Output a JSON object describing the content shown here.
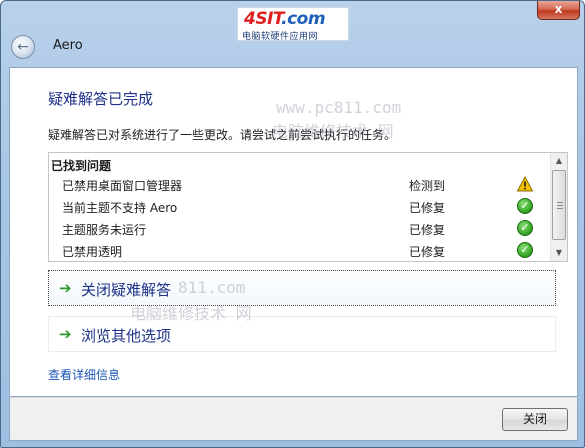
{
  "window": {
    "title": "Aero",
    "close_glyph": "x",
    "back_glyph": "←"
  },
  "logo": {
    "brand_main": "4SIT",
    "brand_suffix": ".com",
    "subtitle": "电脑软硬件应用网"
  },
  "watermark": {
    "url": "www.pc811.com",
    "text": "电脑维修技术 网",
    "url_short": "811.com"
  },
  "main": {
    "heading": "疑难解答已完成",
    "description": "疑难解答已对系统进行了一些更改。请尝试之前尝试执行的任务。"
  },
  "problems": {
    "header": "已找到问题",
    "rows": [
      {
        "name": "已禁用桌面窗口管理器",
        "status": "检测到",
        "icon": "warning-icon"
      },
      {
        "name": "当前主题不支持 Aero",
        "status": "已修复",
        "icon": "check-icon"
      },
      {
        "name": "主题服务未运行",
        "status": "已修复",
        "icon": "check-icon"
      },
      {
        "name": "已禁用透明",
        "status": "已修复",
        "icon": "check-icon"
      }
    ]
  },
  "commands": {
    "close_troubleshooting": "关闭疑难解答",
    "browse_options": "浏览其他选项",
    "arrow_glyph": "➔"
  },
  "links": {
    "view_details": "查看详细信息"
  },
  "footer": {
    "close_label": "关闭"
  },
  "colors": {
    "heading": "#1e3287",
    "link": "#1a55b3",
    "check": "#3aaa2a",
    "warning": "#f2c100"
  }
}
